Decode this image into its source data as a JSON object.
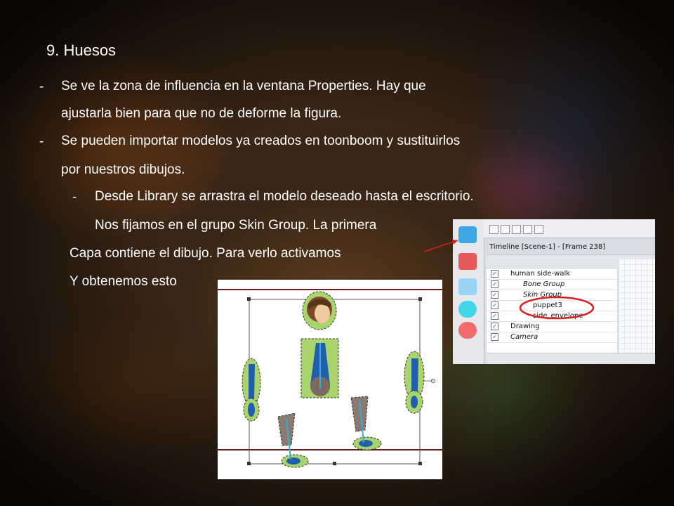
{
  "slide": {
    "title": "9. Huesos",
    "bullets": [
      {
        "marker": "-",
        "lines": [
          "Se ve la zona de influencia en la ventana Properties. Hay que",
          "ajustarla bien para que no  de deforme la figura."
        ]
      },
      {
        "marker": "-",
        "lines": [
          "Se pueden importar modelos ya creados en toonboom y sustituirlos",
          "por nuestros dibujos."
        ]
      }
    ],
    "sub_bullet": {
      "marker": "-",
      "lines": [
        "Desde Library se arrastra el modelo deseado hasta el escritorio.",
        "Nos fijamos en el grupo Skin Group. La primera"
      ]
    },
    "continuation": [
      "Capa contiene el dibujo. Para verlo activamos",
      "Y obtenemos esto"
    ]
  },
  "timeline_panel": {
    "title": "Timeline [Scene-1] - [Frame 238]",
    "layers": [
      {
        "name": "human side-walk",
        "icon": "group-icon",
        "checked": true,
        "italic": false
      },
      {
        "name": "Bone Group",
        "icon": "bone-icon",
        "checked": true,
        "italic": true
      },
      {
        "name": "Skin Group",
        "icon": "skin-icon",
        "checked": true,
        "italic": true
      },
      {
        "name": "puppet3",
        "icon": "drawing-layer-icon",
        "checked": true,
        "italic": false,
        "highlighted": true
      },
      {
        "name": "side_envelope",
        "icon": "drawing-layer-icon",
        "checked": true,
        "italic": false
      },
      {
        "name": "Drawing",
        "icon": "drawing-layer-icon",
        "checked": true,
        "italic": false
      },
      {
        "name": "Camera",
        "icon": "camera-icon",
        "checked": true,
        "italic": true
      }
    ]
  },
  "colors": {
    "text": "#ffffff",
    "highlight_circle": "#d81f1f",
    "arrow": "#d81f1f",
    "frame_line": "#6b1d1d",
    "bone_blue": "#1f5fae",
    "shape_green": "#a9d36b"
  }
}
